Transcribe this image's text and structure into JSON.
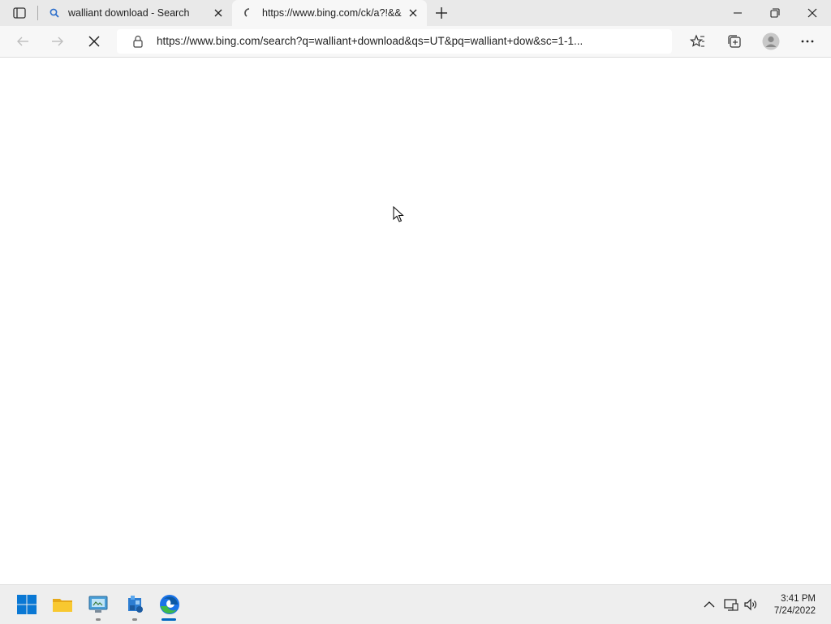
{
  "browser": {
    "tabs": [
      {
        "title": "walliant download - Search"
      },
      {
        "title": "https://www.bing.com/ck/a?!&&p"
      }
    ],
    "address_bar": {
      "url": "https://www.bing.com/search?q=walliant+download&qs=UT&pq=walliant+dow&sc=1-1..."
    }
  },
  "taskbar": {
    "clock": {
      "time": "3:41 PM",
      "date": "7/24/2022"
    }
  },
  "colors": {
    "accent": "#0067c0",
    "edge_blue": "#1a73e8",
    "edge_green": "#3dba4a"
  }
}
